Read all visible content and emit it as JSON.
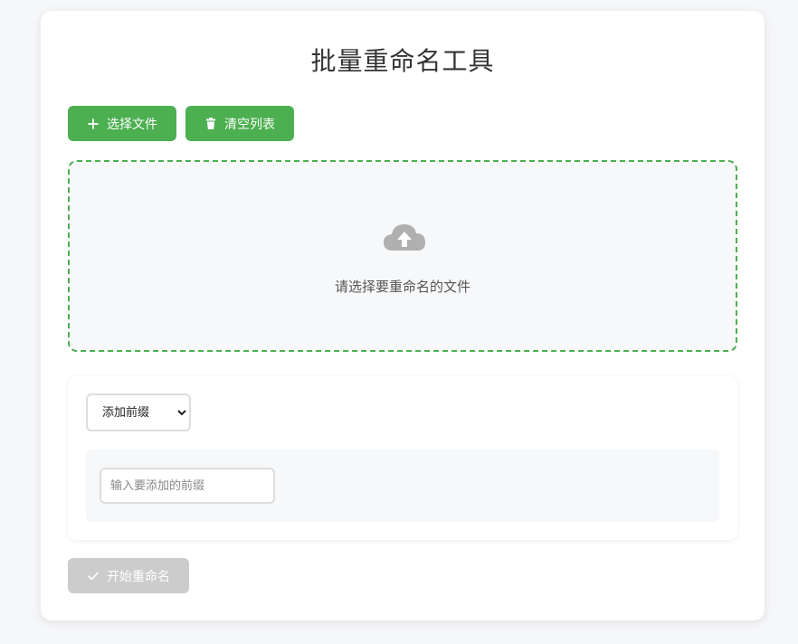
{
  "page": {
    "title": "批量重命名工具"
  },
  "toolbar": {
    "select_files_label": "选择文件",
    "clear_list_label": "清空列表"
  },
  "dropzone": {
    "icon": "cloud-upload-icon",
    "text": "请选择要重命名的文件"
  },
  "options": {
    "mode_selected": "添加前缀",
    "prefix_placeholder": "输入要添加的前缀"
  },
  "actions": {
    "start_label": "开始重命名",
    "start_disabled": true
  },
  "colors": {
    "accent": "#4caf50",
    "disabled": "#cccccc",
    "background": "#f6f7f9"
  }
}
